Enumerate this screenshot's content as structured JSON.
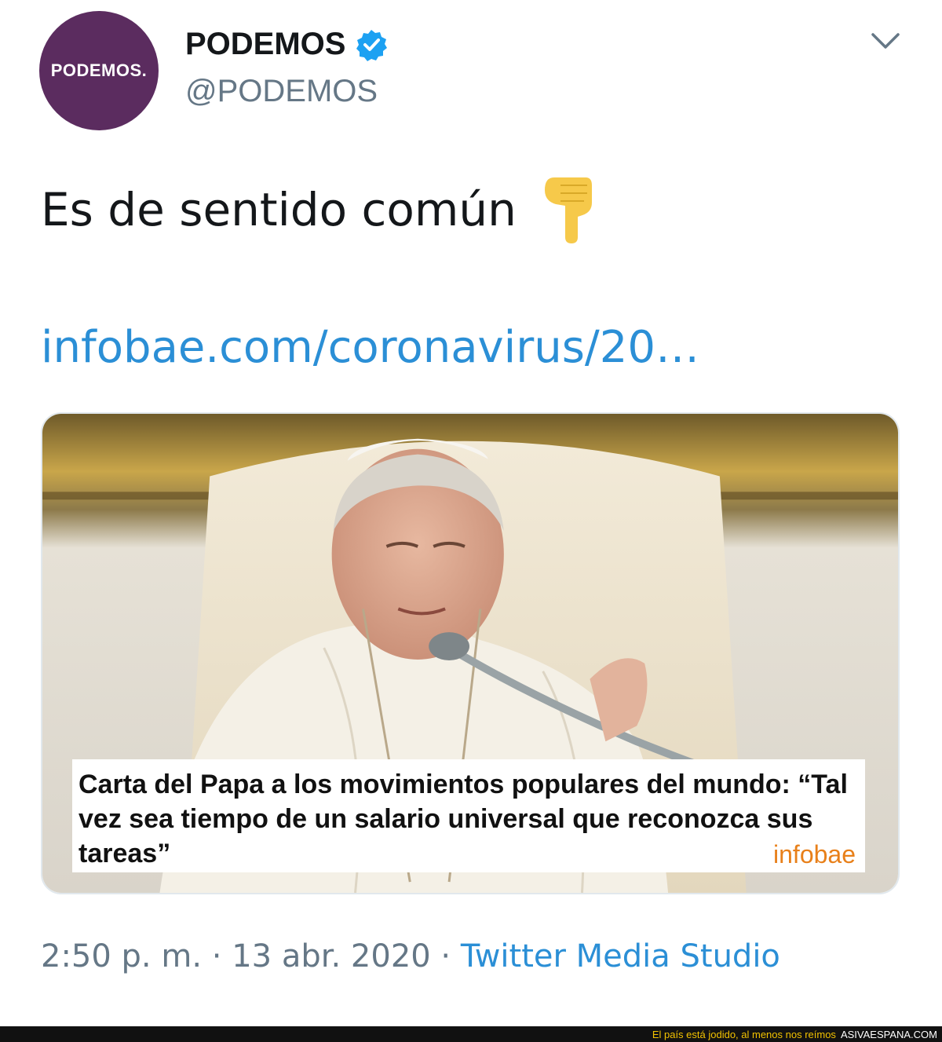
{
  "header": {
    "avatar_text": "PODEMOS.",
    "display_name": "PODEMOS",
    "handle": "@PODEMOS"
  },
  "tweet": {
    "text": "Es de sentido común",
    "emoji": "pointing-down-icon",
    "link": "infobae.com/coronavirus/20…"
  },
  "card": {
    "headline": "Carta del Papa a los movimientos populares del mundo: “Tal vez sea tiempo de un salario universal que reconozca sus tareas”",
    "brand": "infobae"
  },
  "meta": {
    "time": "2:50 p. m.",
    "separator": " · ",
    "date": "13 abr. 2020",
    "source": "Twitter Media Studio"
  },
  "footer": {
    "tagline": "El país está jodido, al menos nos reímos",
    "site": "ASIVAESPANA.COM"
  },
  "colors": {
    "avatar_bg": "#5b2c5f",
    "link": "#2b8fd6",
    "verified": "#1da1f2",
    "brand": "#e8801a",
    "muted": "#657786"
  }
}
